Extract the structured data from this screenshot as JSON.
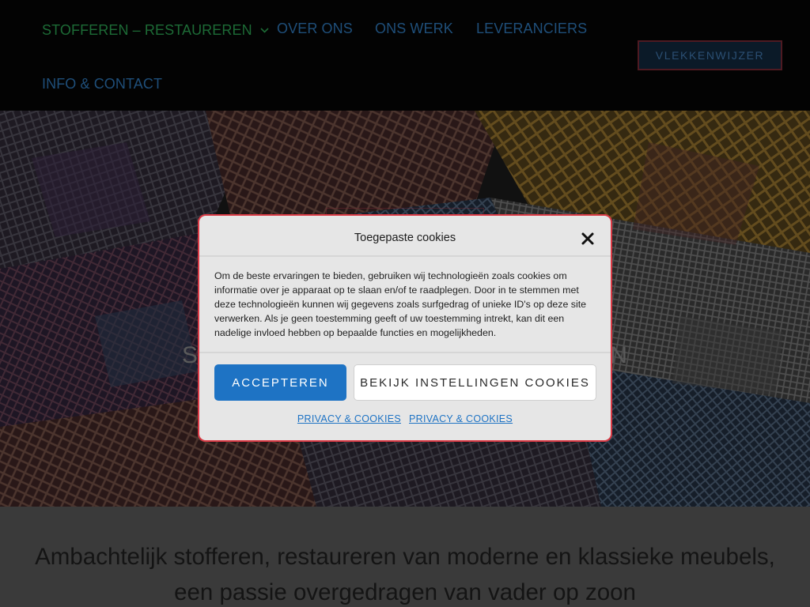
{
  "nav": {
    "items": [
      {
        "label": "STOFFEREN – RESTAUREREN"
      },
      {
        "label": "OVER ONS"
      },
      {
        "label": "ONS WERK"
      },
      {
        "label": "LEVERANCIERS"
      },
      {
        "label": "INFO & CONTACT"
      }
    ],
    "cta_label": "VLEKKENWIJZER",
    "dropdown_icon": "chevron-down-icon"
  },
  "hero": {
    "title_start": "S",
    "title_end": "N"
  },
  "intro": {
    "heading": "Ambachtelijk stofferen, restaureren van moderne en klassieke meubels, een passie overgedragen van vader op zoon"
  },
  "cookie_dialog": {
    "title": "Toegepaste cookies",
    "close_icon": "close-icon",
    "body": "Om de beste ervaringen te bieden, gebruiken wij technologieën zoals cookies om informatie over je apparaat op te slaan en/of te raadplegen. Door in te stemmen met deze technologieën kunnen wij gegevens zoals surfgedrag of unieke ID's op deze site verwerken. Als je geen toestemming geeft of uw toestemming intrekt, kan dit een nadelige invloed hebben op bepaalde functies en mogelijkheden.",
    "accept_label": "ACCEPTEREN",
    "settings_label": "BEKIJK INSTELLINGEN COOKIES",
    "links": [
      {
        "label": "PRIVACY & COOKIES"
      },
      {
        "label": "PRIVACY & COOKIES"
      }
    ]
  },
  "colors": {
    "accent": "#1e73c4",
    "dialog_border": "#d93a45",
    "nav_link": "#1f4f7a",
    "nav_active": "#1d6b36",
    "header_bg": "#030303"
  }
}
